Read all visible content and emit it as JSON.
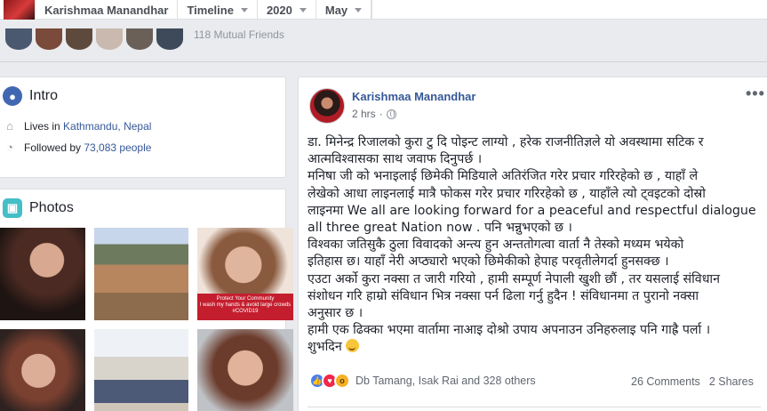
{
  "nav": {
    "profile_name": "Karishmaa Manandhar",
    "timeline_label": "Timeline",
    "year_label": "2020",
    "month_label": "May"
  },
  "friends": {
    "mutual_text": "118 Mutual Friends"
  },
  "intro": {
    "title": "Intro",
    "lives_prefix": "Lives in",
    "city": "Kathmandu, Nepal",
    "followed_prefix": "Followed by",
    "followers": "73,083 people"
  },
  "photos": {
    "title": "Photos",
    "covid_caption": "Protect Your Community\nI wash my hands & avoid large crowds\n#COVID19"
  },
  "post": {
    "author": "Karishmaa Manandhar",
    "time": "2 hrs",
    "dot": "·",
    "more": "•••",
    "lines": [
      "डा. मिनेन्द्र रिजालको कुरा टु दि पोइन्ट लाग्यो , हरेक राजनीतिज्ञले यो अवस्थामा सटिक र",
      "आत्मविश्वासका साथ जवाफ दिनुपर्छ ।",
      "मनिषा जी को भनाइलाई छिमेकी मिडियाले अतिरंजित गरेर प्रचार गरिरहेको छ , याहाँ ले",
      "लेखेको आधा लाइनलाई मात्रै फोकस गरेर प्रचार गरिरहेको छ , याहाँले त्यो ट्वइटको दोस्रो",
      "लाइनमा We all are looking forward for a peaceful and respectful dialogue between",
      "all three great Nation now . पनि भन्नुभएको छ ।",
      "विश्वका जतिसुकै ठुला विवादको अन्त्य हुन अन्ततोगत्वा वार्ता नै तेस्को मध्यम भयेको",
      "इतिहास छ। याहाँ नेरी अप्ठ्यारो भएको छिमेकीको हेपाह परवृतीलेगर्दा हुनसक्छ ।",
      "एउटा अर्को कुरा नक्सा त जारी गरियो , हामी सम्पूर्ण नेपाली खुशी छौं , तर यसलाई संविधान",
      "संशोधन गरि हाम्रो संविधान भित्र नक्सा पर्न ढिला गर्नु हुदैन ! संविधानमा त पुरानो नक्सा",
      "अनुसार छ ।",
      "हामी एक ढिक्का भएमा वार्तामा नाआइ दोश्रो उपाय अपनाउन उनिहरुलाइ पनि गाह्रै पर्ला ।"
    ],
    "closing": "शुभदिन",
    "reaction_names": "Db Tamang, Isak Rai and 328 others",
    "comments": "26 Comments",
    "shares": "2 Shares"
  },
  "colors": {
    "link": "#365899",
    "background": "#e9ebee"
  },
  "icons": [
    "home-icon",
    "rss-icon",
    "globe-icon",
    "more-icon",
    "like-icon",
    "love-icon",
    "wow-icon",
    "smile-emoji-icon"
  ]
}
